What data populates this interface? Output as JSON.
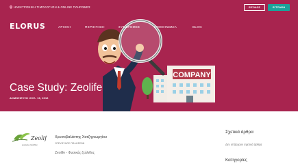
{
  "topbar": {
    "tagline": "ΗΛΕΚΤΡΟΝΙΚΗ ΤΙΜΟΛΟΓΗΣΗ & ONLINE ΠΛΗΡΩΜΕΣ",
    "login_label": "ΕΙΣΟΔΟΣ",
    "signup_label": "ΕΓΓΡΑΦΗ"
  },
  "brand": {
    "logo_text": "ELORUS"
  },
  "nav": {
    "items": [
      {
        "label": "ΑΡΧΙΚΗ"
      },
      {
        "label": "ΠΕΡΙΗΓΗΣΗ"
      },
      {
        "label": "ΣΥΝΔΡΟΜΕΣ"
      },
      {
        "label": "ΕΠΙΚΟΙΝΩΝΙΑ"
      },
      {
        "label": "BLOG"
      }
    ]
  },
  "hero": {
    "title": "Case Study: Zeolife",
    "date": "ΔΗΜΟΣΙΕΥΣΗ ΙΟΥΛ. 19, 2016",
    "building_sign": "COMPANY"
  },
  "author": {
    "name": "Χρυσοβαλάντης Χατζηγεωργίου",
    "role": "ΥΠΕΥΘΥΝΟΣ ΠΩΛΗΣΕΩΝ",
    "company": "Zeolife - Φυσικός ζεόλιθος",
    "logo_text": "Zeolife",
    "logo_subtext": "φυσικός ζεόλιθος"
  },
  "sidebar": {
    "related_title": "Σχετικά άρθρα",
    "related_empty": "Δεν υπάρχουν σχετικά άρθρα",
    "categories_title": "Κατηγορίες"
  },
  "colors": {
    "hero_bg": "#a8244f",
    "accent_teal": "#1aa39a"
  }
}
